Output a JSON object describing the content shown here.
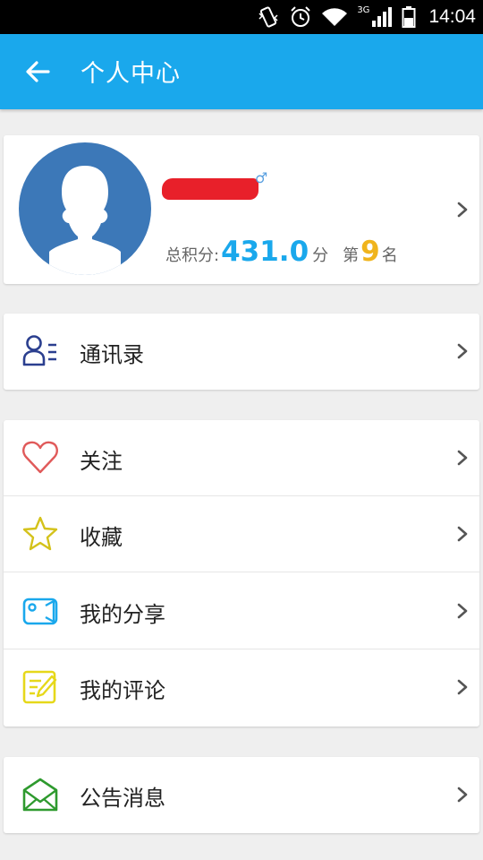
{
  "status": {
    "time": "14:04",
    "network": "3G"
  },
  "appbar": {
    "title": "个人中心"
  },
  "profile": {
    "gender": "♂",
    "score_label": "总积分:",
    "score_value": "431.0",
    "score_unit": "分",
    "rank_prefix": "第",
    "rank_value": "9",
    "rank_suffix": "名"
  },
  "group1": [
    {
      "label": "通讯录",
      "icon": "contacts-icon",
      "color": "#2b3f8f"
    }
  ],
  "group2": [
    {
      "label": "关注",
      "icon": "heart-icon",
      "color": "#e05a5a"
    },
    {
      "label": "收藏",
      "icon": "star-icon",
      "color": "#d4c21a"
    },
    {
      "label": "我的分享",
      "icon": "video-share-icon",
      "color": "#1aa8ec"
    },
    {
      "label": "我的评论",
      "icon": "comment-edit-icon",
      "color": "#e6d81a"
    }
  ],
  "group3": [
    {
      "label": "公告消息",
      "icon": "mail-icon",
      "color": "#2e9a2e"
    }
  ]
}
